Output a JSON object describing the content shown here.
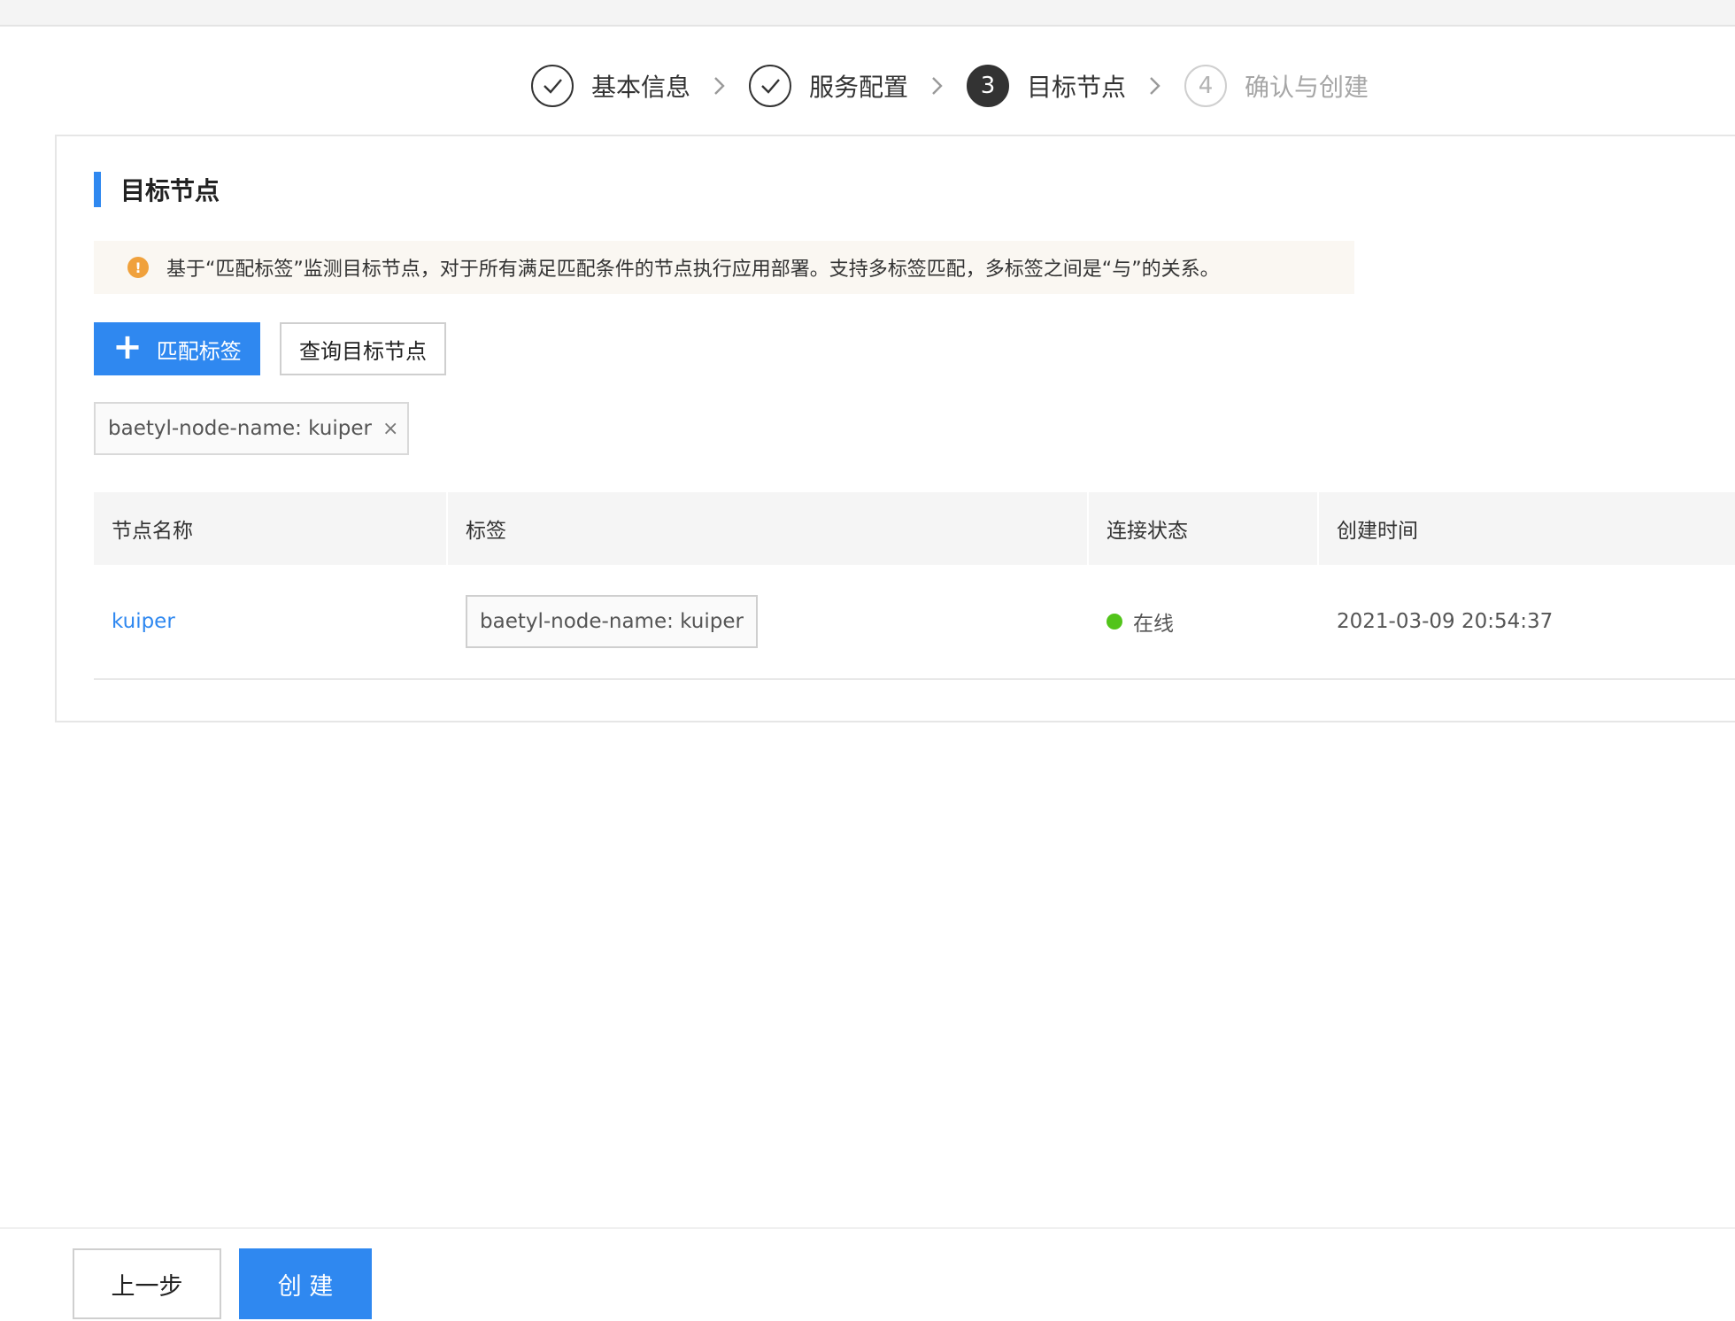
{
  "steps": [
    {
      "label": "基本信息",
      "state": "done"
    },
    {
      "label": "服务配置",
      "state": "done"
    },
    {
      "label": "目标节点",
      "state": "active",
      "number": "3"
    },
    {
      "label": "确认与创建",
      "state": "pending",
      "number": "4"
    }
  ],
  "section": {
    "title": "目标节点"
  },
  "notice": {
    "icon": "warning-icon",
    "text": "基于“匹配标签”监测目标节点，对于所有满足匹配条件的节点执行应用部署。支持多标签匹配，多标签之间是“与”的关系。"
  },
  "actions": {
    "add_label": "匹配标签",
    "query_label": "查询目标节点"
  },
  "filter_tag": {
    "text": "baetyl-node-name: kuiper",
    "close": "×"
  },
  "table": {
    "columns": [
      "节点名称",
      "标签",
      "连接状态",
      "创建时间"
    ],
    "rows": [
      {
        "name": "kuiper",
        "tag": "baetyl-node-name: kuiper",
        "status": "在线",
        "created": "2021-03-09 20:54:37"
      }
    ]
  },
  "footer": {
    "prev_label": "上一步",
    "create_label": "创 建"
  },
  "colors": {
    "primary": "#2f88f0",
    "online": "#52c41a",
    "warning": "#f0a13c"
  }
}
